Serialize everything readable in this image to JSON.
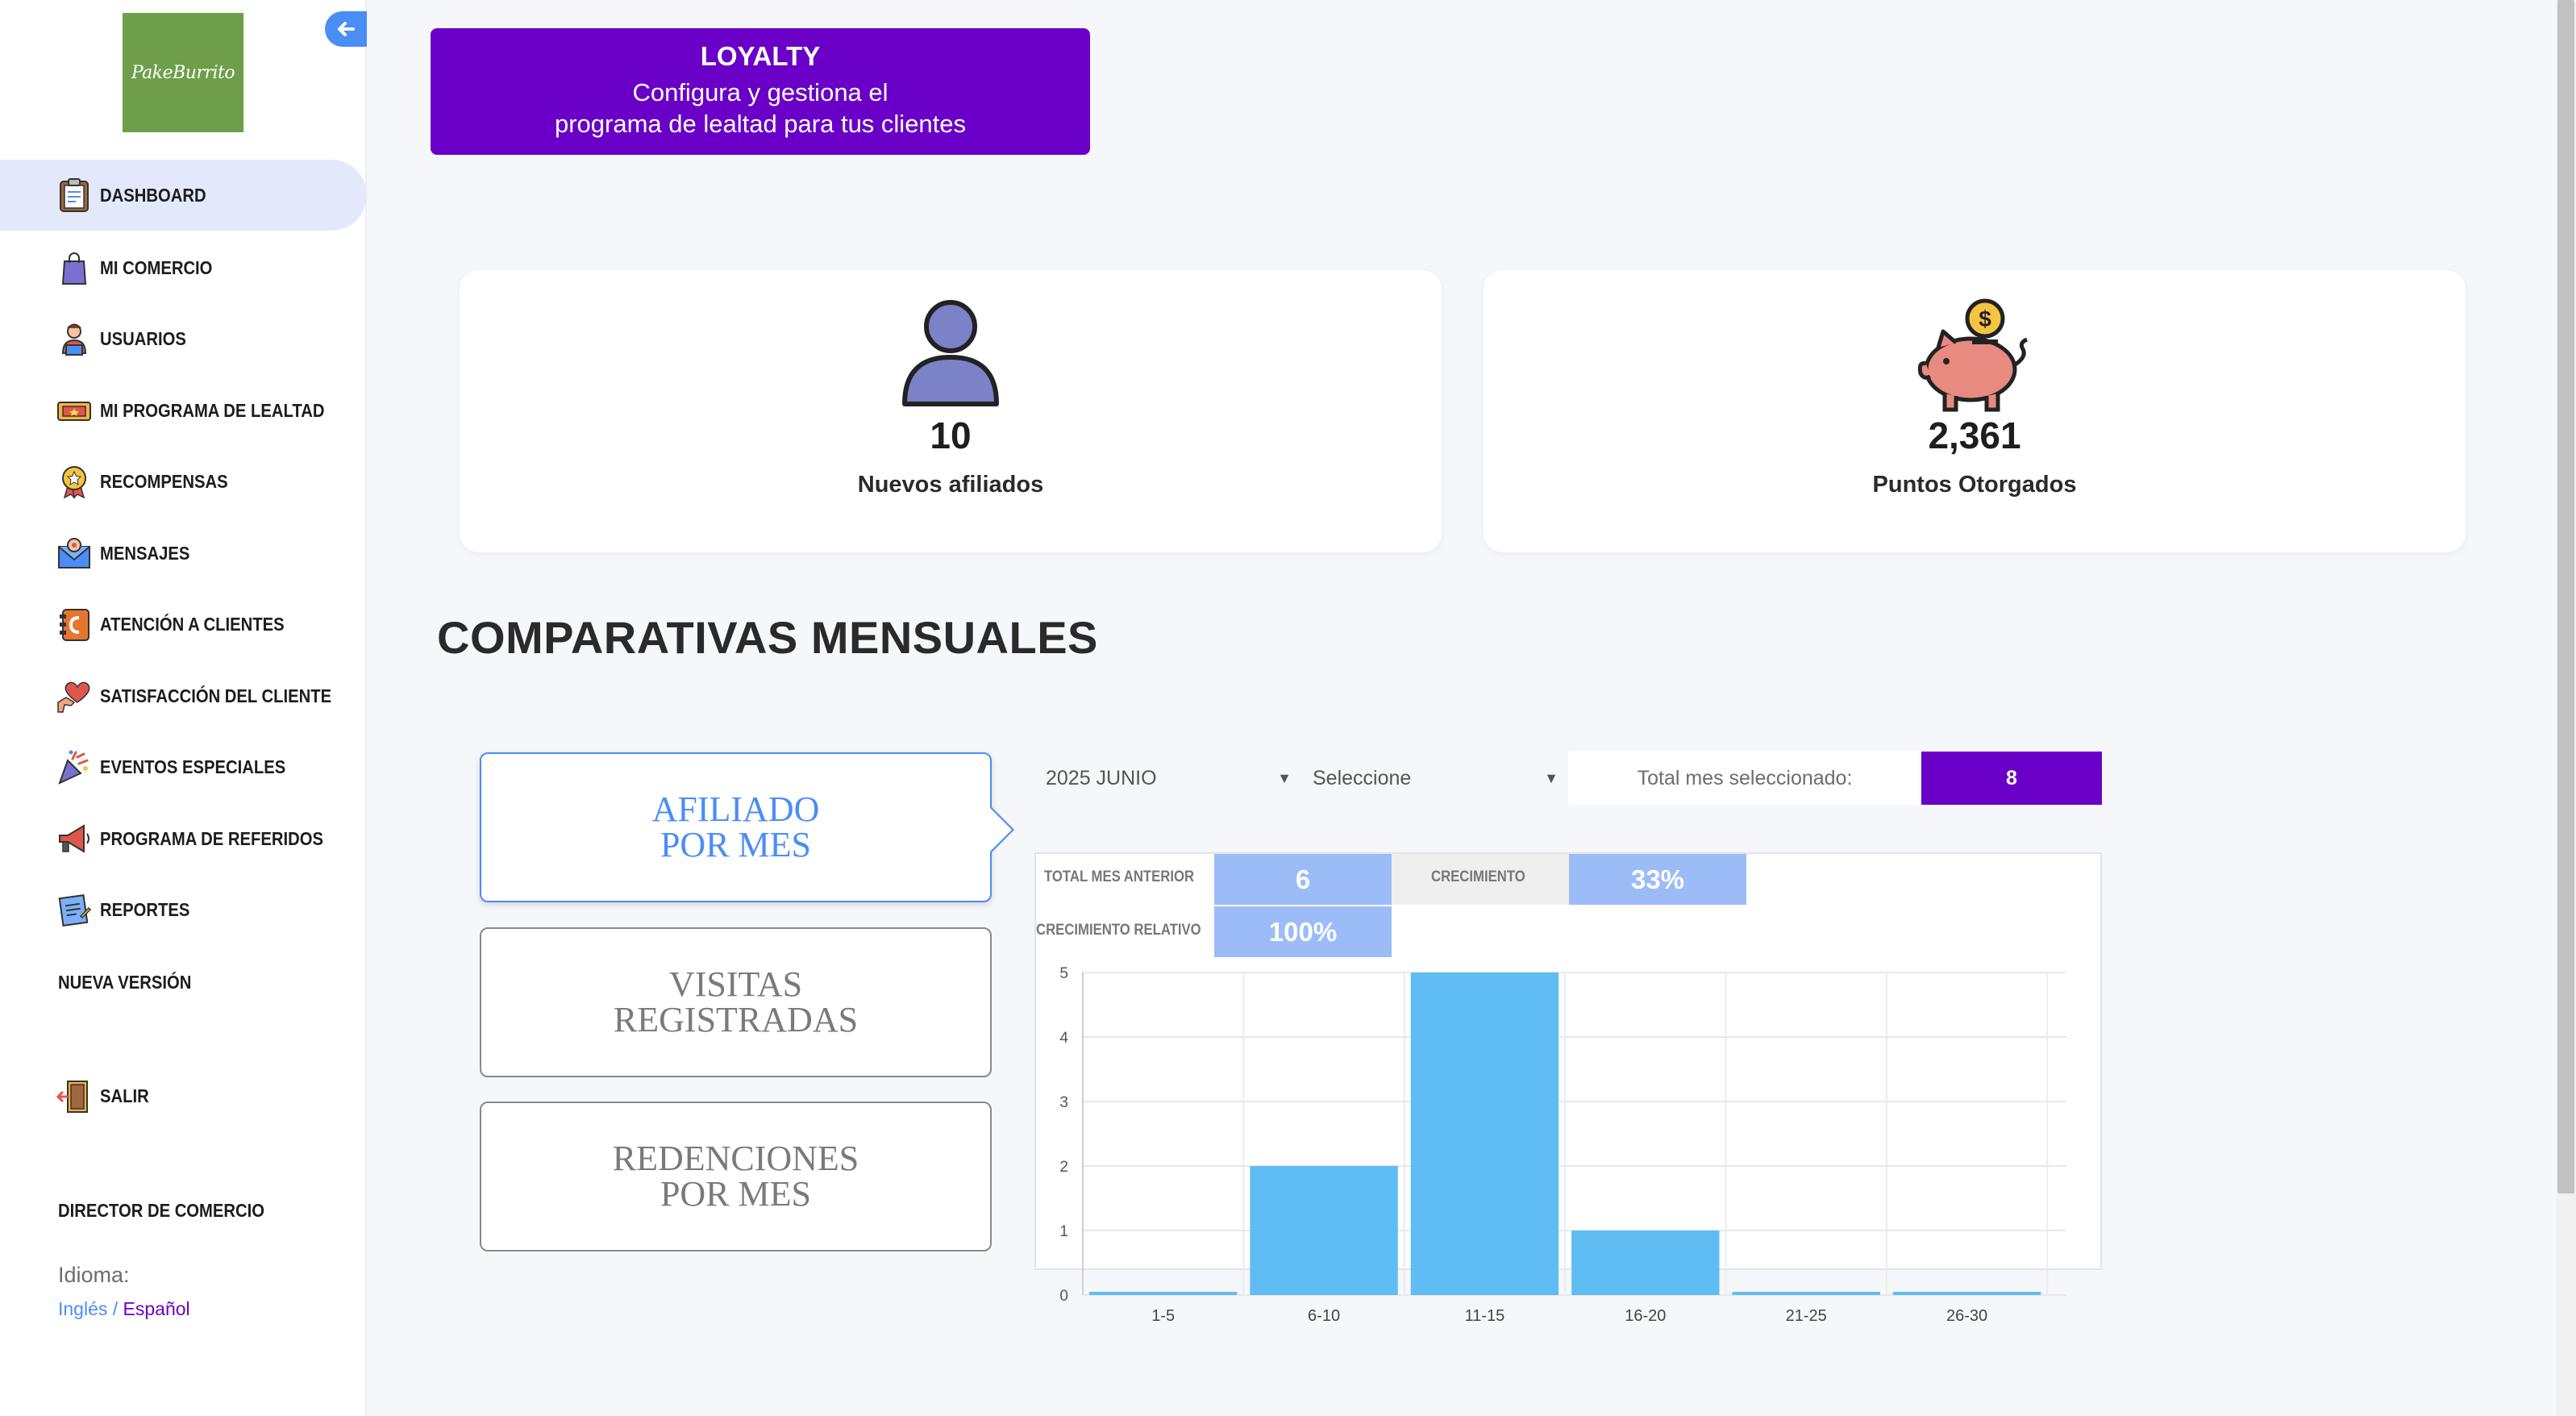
{
  "sidebar": {
    "logo_text": "PakeBurrito",
    "items": [
      {
        "label": "DASHBOARD",
        "icon": "clipboard-icon"
      },
      {
        "label": "MI COMERCIO",
        "icon": "shopping-bag-icon"
      },
      {
        "label": "USUARIOS",
        "icon": "user-laptop-icon"
      },
      {
        "label": "MI PROGRAMA DE LEALTAD",
        "icon": "ticket-icon"
      },
      {
        "label": "RECOMPENSAS",
        "icon": "award-badge-icon"
      },
      {
        "label": "MENSAJES",
        "icon": "envelope-icon"
      },
      {
        "label": "ATENCIÓN A CLIENTES",
        "icon": "phone-book-icon"
      },
      {
        "label": "SATISFACCIÓN DEL CLIENTE",
        "icon": "heart-hand-icon"
      },
      {
        "label": "EVENTOS ESPECIALES",
        "icon": "party-popper-icon"
      },
      {
        "label": "PROGRAMA DE REFERIDOS",
        "icon": "megaphone-icon"
      },
      {
        "label": "REPORTES",
        "icon": "report-icon"
      }
    ],
    "new_version": "NUEVA VERSIÓN",
    "logout": "SALIR",
    "role": "DIRECTOR DE COMERCIO",
    "language_title": "Idioma:",
    "lang_en": "Inglés",
    "lang_sep": " / ",
    "lang_es": "Español"
  },
  "banner": {
    "title": "LOYALTY",
    "line1": "Configura y gestiona el",
    "line2": "programa de lealtad para tus clientes"
  },
  "stats": {
    "new_affiliates_value": "10",
    "new_affiliates_label": "Nuevos afiliados",
    "points_value": "2,361",
    "points_label": "Puntos Otorgados"
  },
  "section_title": "COMPARATIVAS MENSUALES",
  "metric_tabs": [
    {
      "line1": "AFILIADO",
      "line2": "POR MES"
    },
    {
      "line1": "VISITAS",
      "line2": "REGISTRADAS"
    },
    {
      "line1": "REDENCIONES",
      "line2": "POR MES"
    }
  ],
  "filters": {
    "month": "2025 JUNIO",
    "second": "Seleccione",
    "total_label": "Total mes seleccionado:",
    "total_value": "8"
  },
  "comparison": {
    "prev_label": "TOTAL MES ANTERIOR",
    "prev_value": "6",
    "growth_label": "CRECIMIENTO",
    "growth_value": "33%",
    "relative_label": "CRECIMIENTO RELATIVO",
    "relative_value": "100%"
  },
  "colors": {
    "accent": "#6a00c8",
    "primary": "#4a8df6",
    "bar": "#5fbdf4"
  },
  "chart_data": {
    "type": "bar",
    "categories": [
      "1-5",
      "6-10",
      "11-15",
      "16-20",
      "21-25",
      "26-30"
    ],
    "values": [
      0,
      2,
      5,
      1,
      0,
      0
    ],
    "ylim": [
      0,
      5
    ],
    "yticks": [
      "0",
      "1",
      "2",
      "3",
      "4",
      "5"
    ],
    "grid": true
  }
}
